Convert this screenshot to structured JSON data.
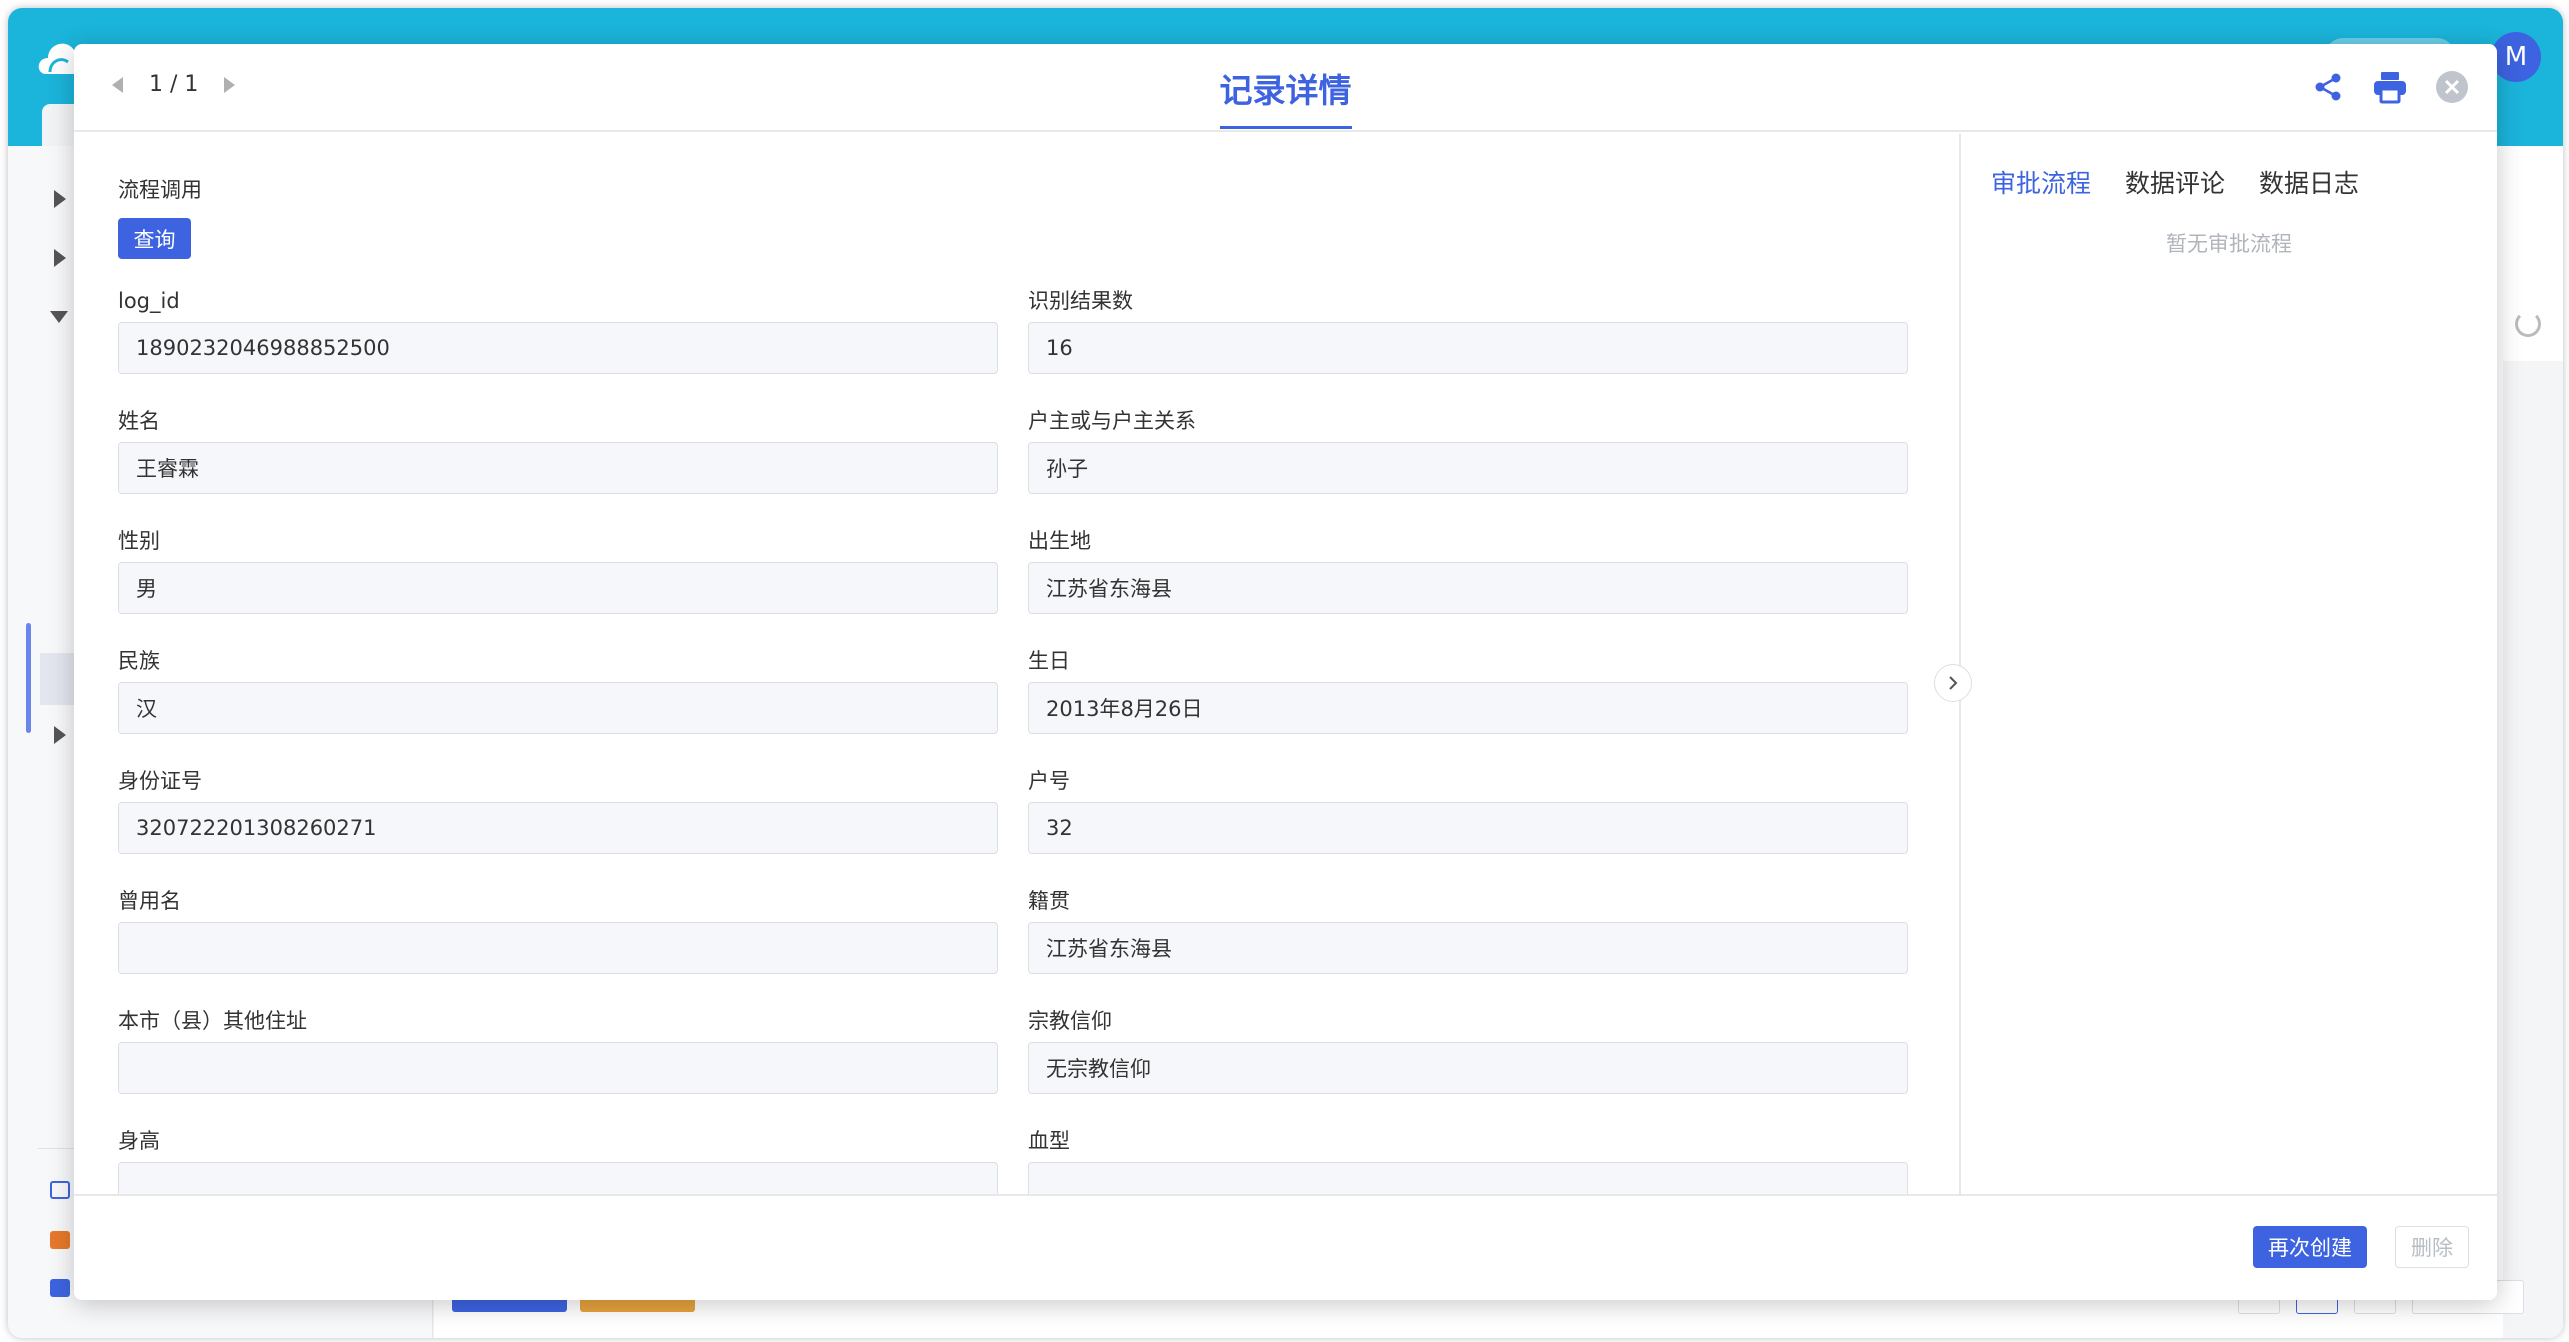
{
  "colors": {
    "accent": "#3d63e0",
    "header_bg": "#1bb4da",
    "orange": "#e6a23c"
  },
  "background_app": {
    "avatar_text": "M",
    "icons": [
      "cloud-logo-icon",
      "refresh-icon",
      "form-icon",
      "table-icon",
      "folder-icon"
    ]
  },
  "modal": {
    "pager": {
      "text": "1 / 1"
    },
    "title": "记录详情",
    "header_icons": [
      "share-icon",
      "print-icon",
      "close-icon"
    ],
    "flow": {
      "label": "流程调用",
      "query_label": "查询"
    },
    "fields": [
      {
        "label": "log_id",
        "value": "1890232046988852500"
      },
      {
        "label": "识别结果数",
        "value": "16"
      },
      {
        "label": "姓名",
        "value": "王睿霖"
      },
      {
        "label": "户主或与户主关系",
        "value": "孙子"
      },
      {
        "label": "性别",
        "value": "男"
      },
      {
        "label": "出生地",
        "value": "江苏省东海县"
      },
      {
        "label": "民族",
        "value": "汉"
      },
      {
        "label": "生日",
        "value": "2013年8月26日"
      },
      {
        "label": "身份证号",
        "value": "320722201308260271"
      },
      {
        "label": "户号",
        "value": "32"
      },
      {
        "label": "曾用名",
        "value": ""
      },
      {
        "label": "籍贯",
        "value": "江苏省东海县"
      },
      {
        "label": "本市（县）其他住址",
        "value": ""
      },
      {
        "label": "宗教信仰",
        "value": "无宗教信仰"
      },
      {
        "label": "身高",
        "value": ""
      },
      {
        "label": "血型",
        "value": ""
      }
    ],
    "side_panel": {
      "tabs": [
        "审批流程",
        "数据评论",
        "数据日志"
      ],
      "active_tab": 0,
      "empty_text": "暂无审批流程"
    },
    "footer": {
      "recreate_label": "再次创建",
      "delete_label": "删除"
    }
  }
}
